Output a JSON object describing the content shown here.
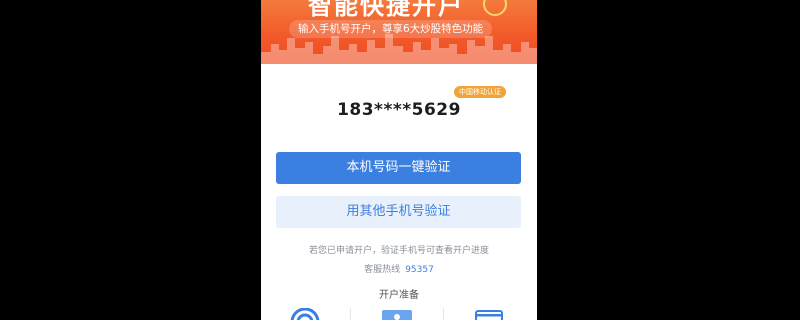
{
  "banner": {
    "title": "智能快捷开户",
    "subtitle": "输入手机号开户，尊享6大炒股特色功能"
  },
  "verification": {
    "badge": "中国移动认证",
    "masked_phone": "183****5629"
  },
  "buttons": {
    "one_click": "本机号码一键验证",
    "other_number": "用其他手机号验证"
  },
  "info": {
    "note": "若您已申请开户，验证手机号可查看开户进度",
    "hotline_label": "客服热线",
    "hotline_number": "95357"
  },
  "preparation": {
    "title": "开户准备",
    "icons": [
      "wifi-icon",
      "id-card-icon",
      "bank-card-icon"
    ]
  },
  "colors": {
    "banner": "#f25a2a",
    "primary": "#3b7fe0",
    "secondary_bg": "#e8f0fb",
    "badge": "#f0a43a"
  }
}
